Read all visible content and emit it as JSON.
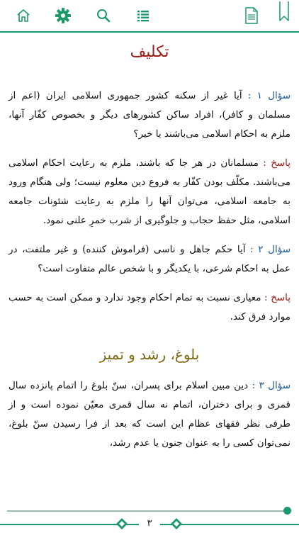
{
  "toolbar": {
    "icons": [
      "home-icon",
      "gear-icon",
      "search-icon",
      "list-icon",
      "page-icon",
      "bookmark-icon"
    ],
    "accent": "#1a9a6a"
  },
  "content": {
    "title": "تکلیف",
    "q1_label": "سؤال ۱ :",
    "q1_text": " آیا غیر از سکنه کشور جمهوری اسلامی ایران (اعم از مسلمان و کافر)، افراد ساکن کشورهای دیگر و بخصوص کفّار آنها، ملزم به احکام اسلامی می‌باشند یا خیر؟",
    "a1_label": "پاسخ :",
    "a1_text": " مسلمانان در هر جا که باشند، ملزم به رعایت احکام اسلامی می‌باشند. مکلّف بودن کفّار به فروع دین معلوم نیست؛ ولی هنگام ورود به جامعه اسلامی، می‌توان آنها را ملزم به رعایت شئونات جامعه اسلامی، مثل حفظ حجاب و جلوگیری از شرب خمرِ علنی نمود.",
    "q2_label": "سؤال ۲ :",
    "q2_text": " آیا حکم جاهل و ناسی (فراموش کننده) و غیر ملتفت، در عمل به احکام شرعی، با یکدیگر و با شخص عالم متفاوت است؟",
    "a2_label": "پاسخ :",
    "a2_text": " معیاری نسبت به تمام احکام وجود ندارد و ممکن است به حسب موارد فرق کند.",
    "subtitle": "بلوغ، رشد و تمیز",
    "q3_label": "سؤال ۳ :",
    "q3_text": " دین مبین اسلام برای پسران، سنّ بلوغ را اتمام پانزده سال قمری و برای دختران، اتمام نه سال قمری معیّن نموده است و از طرفی نظر فقهای عظام این است که بعد از فرا رسیدن سنّ بلوغ، نمی‌توان کسی را به عنوان جنون یا عدم رشد،"
  },
  "footer": {
    "page_number": "۳",
    "progress": 0.98
  }
}
